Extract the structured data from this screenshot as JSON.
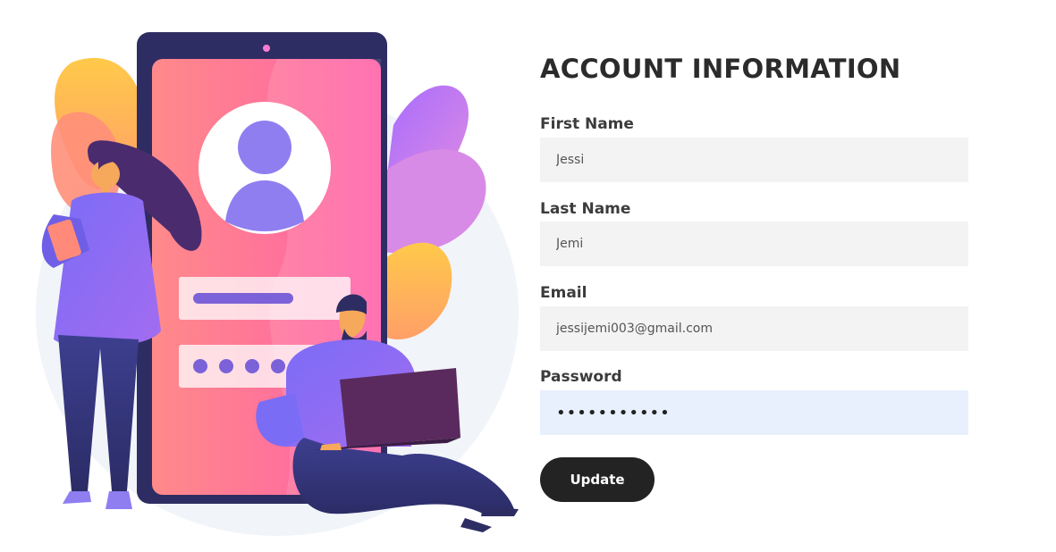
{
  "form": {
    "title": "ACCOUNT INFORMATION",
    "fields": [
      {
        "label": "First Name",
        "value": "Jessi",
        "type": "text"
      },
      {
        "label": "Last Name",
        "value": "Jemi",
        "type": "text"
      },
      {
        "label": "Email",
        "value": "jessijemi003@gmail.com",
        "type": "email"
      },
      {
        "label": "Password",
        "value": "passwordxyz",
        "type": "password"
      }
    ],
    "submit_label": "Update"
  },
  "illustration": {
    "icon": "user-profile-illustration"
  }
}
